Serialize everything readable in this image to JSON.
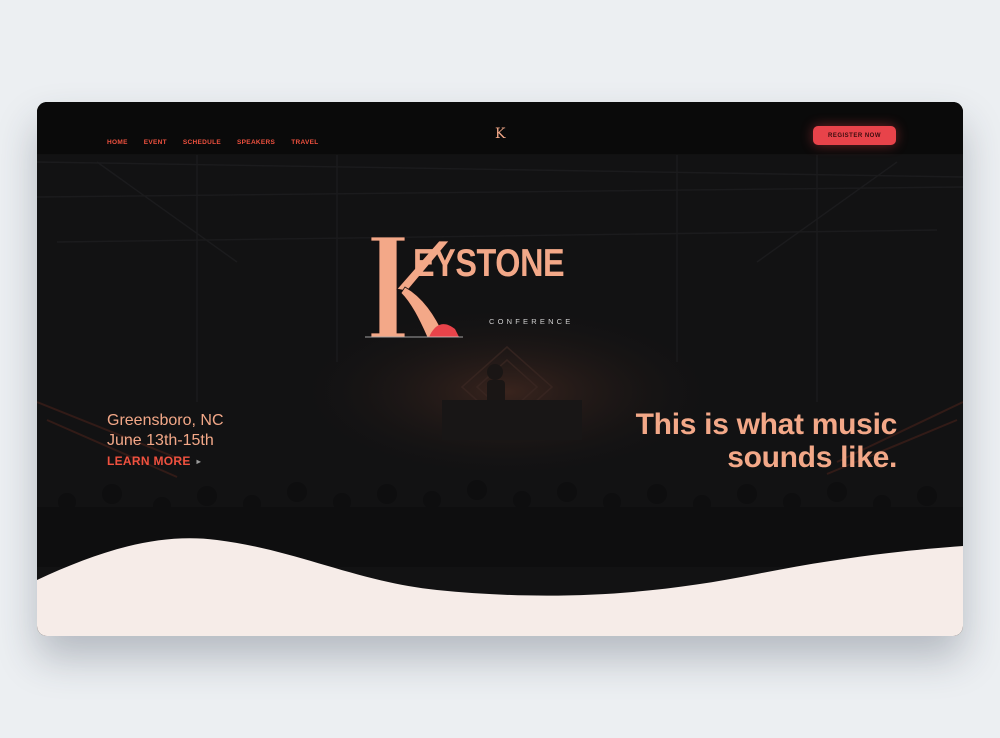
{
  "nav": {
    "items": [
      {
        "label": "HOME"
      },
      {
        "label": "EVENT"
      },
      {
        "label": "SCHEDULE"
      },
      {
        "label": "SPEAKERS"
      },
      {
        "label": "TRAVEL"
      }
    ],
    "logo": "K",
    "register_label": "REGISTER NOW"
  },
  "hero": {
    "brand_initial": "K",
    "brand_rest": "EYSTONE",
    "brand_sub": "CONFERENCE",
    "city": "Greensboro, NC",
    "dates": "June 13th-15th",
    "learn_more": "LEARN MORE",
    "tagline_line1": "This is what music",
    "tagline_line2": "sounds like."
  },
  "colors": {
    "accent": "#e8434a",
    "peach": "#f3a888",
    "background": "#121213",
    "wave": "#f6ece8"
  },
  "icons": {
    "learn_more": "chevron-right-icon"
  }
}
